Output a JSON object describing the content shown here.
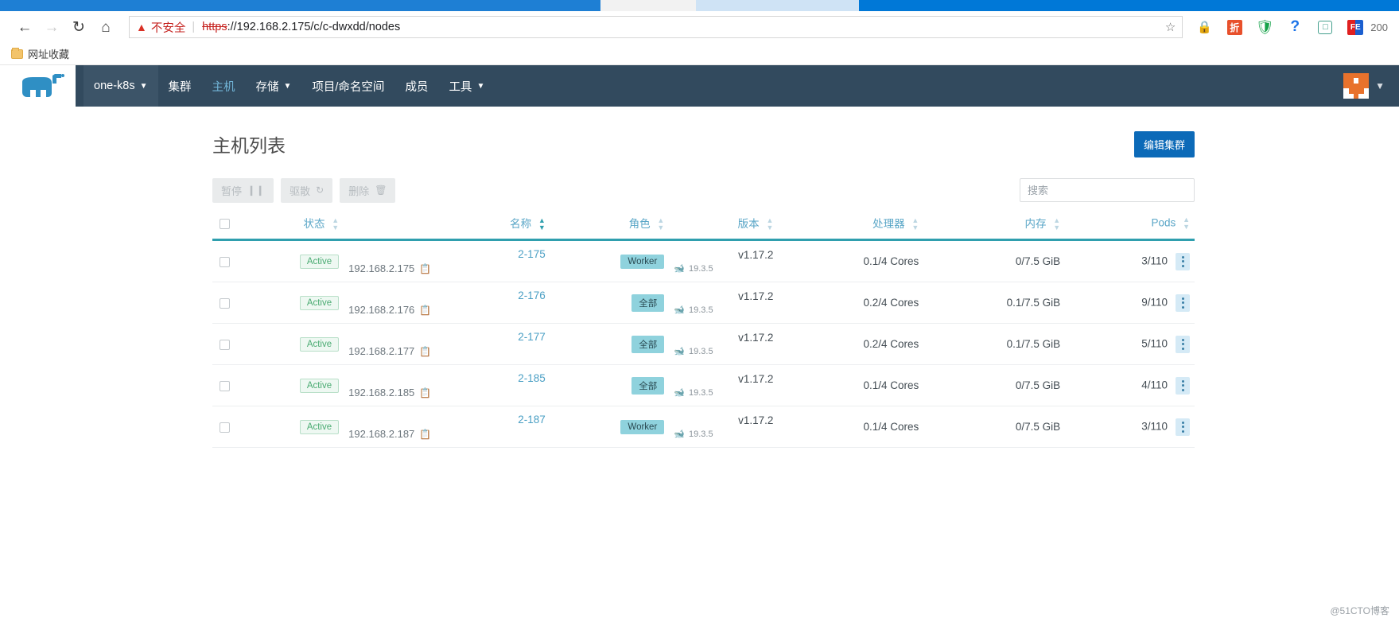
{
  "browser": {
    "back_icon": "back-arrow-icon",
    "forward_icon": "forward-arrow-icon",
    "reload_icon": "reload-icon",
    "home_icon": "home-icon",
    "security_warning": "不安全",
    "url_scheme": "https",
    "url_rest": "://192.168.2.175/c/c-dwxdd/nodes",
    "bookmark_star": "☆",
    "extensions": [
      {
        "name": "lock-extension-icon",
        "glyph": "🔒"
      },
      {
        "name": "discount-extension-icon",
        "glyph": "折"
      },
      {
        "name": "shield-extension-icon",
        "glyph": "U"
      },
      {
        "name": "help-extension-icon",
        "glyph": "?"
      },
      {
        "name": "screenshot-extension-icon",
        "glyph": "▢"
      },
      {
        "name": "fe-extension-icon",
        "glyph": "FE"
      },
      {
        "name": "zoom-level-indicator",
        "glyph": "200"
      }
    ],
    "bookmarks": [
      {
        "label": "网址收藏",
        "icon": "folder-icon"
      }
    ]
  },
  "topnav": {
    "logo": "rancher-cow-logo",
    "cluster": "one-k8s",
    "items": [
      {
        "label": "集群",
        "active": false,
        "caret": false
      },
      {
        "label": "主机",
        "active": true,
        "caret": false
      },
      {
        "label": "存储",
        "active": false,
        "caret": true
      },
      {
        "label": "项目/命名空间",
        "active": false,
        "caret": false
      },
      {
        "label": "成员",
        "active": false,
        "caret": false
      },
      {
        "label": "工具",
        "active": false,
        "caret": true
      }
    ],
    "avatar": "user-avatar-identicon",
    "avatar_caret": "▼"
  },
  "page": {
    "title": "主机列表",
    "edit_cluster_button": "编辑集群"
  },
  "toolbar": {
    "pause_label": "暂停",
    "pause_icon": "pause-icon",
    "drain_label": "驱散",
    "drain_icon": "refresh-icon",
    "delete_label": "删除",
    "delete_icon": "trash-icon"
  },
  "search": {
    "placeholder": "搜索",
    "value": ""
  },
  "table": {
    "columns": [
      {
        "key": "state",
        "label": "状态",
        "align": "left",
        "sortable": true
      },
      {
        "key": "name",
        "label": "名称",
        "align": "left",
        "sortable": true,
        "sorted": true
      },
      {
        "key": "role",
        "label": "角色",
        "align": "right",
        "sortable": true
      },
      {
        "key": "version",
        "label": "版本",
        "align": "right",
        "sortable": true
      },
      {
        "key": "cpu",
        "label": "处理器",
        "align": "right",
        "sortable": true
      },
      {
        "key": "memory",
        "label": "内存",
        "align": "right",
        "sortable": true
      },
      {
        "key": "pods",
        "label": "Pods",
        "align": "right",
        "sortable": true
      }
    ],
    "rows": [
      {
        "state": "Active",
        "name": "2-175",
        "ip": "192.168.2.175",
        "role": "Worker",
        "version": "v1.17.2",
        "docker": "19.3.5",
        "cpu": "0.1/4 Cores",
        "memory": "0/7.5 GiB",
        "pods": "3/110"
      },
      {
        "state": "Active",
        "name": "2-176",
        "ip": "192.168.2.176",
        "role": "全部",
        "version": "v1.17.2",
        "docker": "19.3.5",
        "cpu": "0.2/4 Cores",
        "memory": "0.1/7.5 GiB",
        "pods": "9/110"
      },
      {
        "state": "Active",
        "name": "2-177",
        "ip": "192.168.2.177",
        "role": "全部",
        "version": "v1.17.2",
        "docker": "19.3.5",
        "cpu": "0.2/4 Cores",
        "memory": "0.1/7.5 GiB",
        "pods": "5/110"
      },
      {
        "state": "Active",
        "name": "2-185",
        "ip": "192.168.2.185",
        "role": "全部",
        "version": "v1.17.2",
        "docker": "19.3.5",
        "cpu": "0.1/4 Cores",
        "memory": "0/7.5 GiB",
        "pods": "4/110"
      },
      {
        "state": "Active",
        "name": "2-187",
        "ip": "192.168.2.187",
        "role": "Worker",
        "version": "v1.17.2",
        "docker": "19.3.5",
        "cpu": "0.1/4 Cores",
        "memory": "0/7.5 GiB",
        "pods": "3/110"
      }
    ]
  },
  "watermark": "@51CTO博客",
  "colors": {
    "nav_bg": "#324a5e",
    "accent": "#0c6ab8",
    "table_underline": "#2f9fae",
    "role_badge_bg": "#8fd2dd",
    "state_badge_fg": "#4aab72"
  }
}
